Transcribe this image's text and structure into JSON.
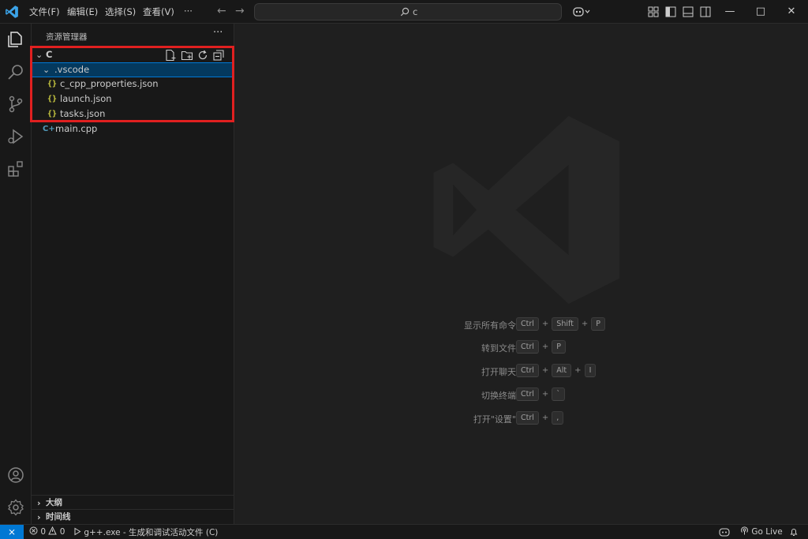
{
  "menu": [
    {
      "id": "file",
      "label": "文件(F)"
    },
    {
      "id": "edit",
      "label": "编辑(E)"
    },
    {
      "id": "selection",
      "label": "选择(S)"
    },
    {
      "id": "view",
      "label": "查看(V)"
    },
    {
      "id": "more",
      "label": "···"
    }
  ],
  "command_center": {
    "text": "c"
  },
  "window_controls": {
    "minimize": "—",
    "maximize": "□",
    "close": "✕"
  },
  "activity_bar": [
    "files-icon",
    "search-icon",
    "source-control-icon",
    "run-debug-icon",
    "extensions-icon",
    "account-icon",
    "settings-gear-icon"
  ],
  "explorer": {
    "title": "资源管理器",
    "more": "···",
    "folder": "C",
    "items": [
      {
        "label": ".vscode",
        "type": "folder",
        "expanded": true,
        "selected": true
      },
      {
        "label": "c_cpp_properties.json",
        "type": "json"
      },
      {
        "label": "launch.json",
        "type": "json"
      },
      {
        "label": "tasks.json",
        "type": "json"
      },
      {
        "label": "main.cpp",
        "type": "cpp"
      }
    ],
    "sections": [
      {
        "label": "大纲"
      },
      {
        "label": "时间线"
      }
    ]
  },
  "editor_hints": [
    {
      "label": "显示所有命令",
      "keys": [
        "Ctrl",
        "Shift",
        "P"
      ]
    },
    {
      "label": "转到文件",
      "keys": [
        "Ctrl",
        "P"
      ]
    },
    {
      "label": "打开聊天",
      "keys": [
        "Ctrl",
        "Alt",
        "I"
      ]
    },
    {
      "label": "切换终端",
      "keys": [
        "Ctrl",
        "`"
      ]
    },
    {
      "label": "打开\"设置\"",
      "keys": [
        "Ctrl",
        ","
      ]
    }
  ],
  "statusbar": {
    "remote": "⨯",
    "errors": "0",
    "warnings": "0",
    "task": "g++.exe - 生成和调试活动文件 (C)",
    "copilot": "",
    "golive": "Go Live"
  },
  "icons": {
    "json": "{}",
    "cpp": "C+",
    "chevron_down": "⌄",
    "chevron_right": "›"
  },
  "colors": {
    "accent": "#0078d4",
    "highlight_box": "#e02020",
    "json": "#cbcb41",
    "cpp": "#519aba"
  }
}
